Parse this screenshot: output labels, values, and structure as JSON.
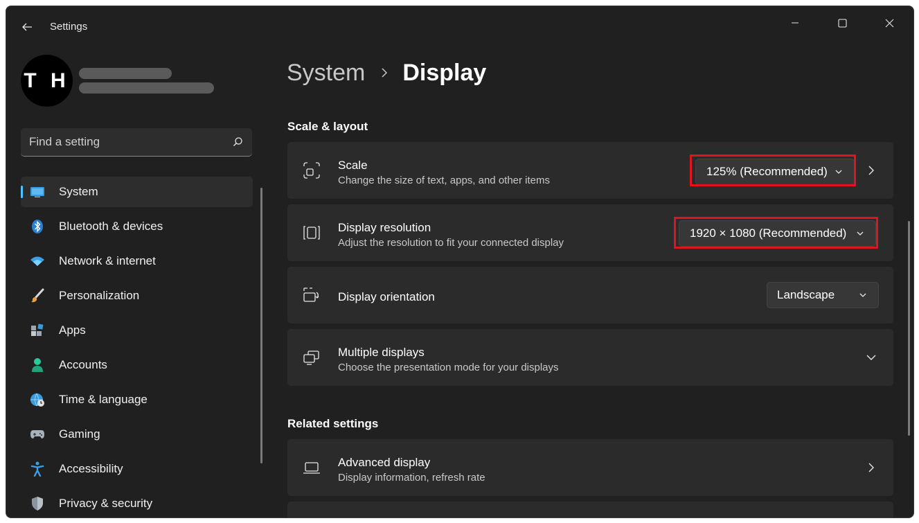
{
  "window": {
    "title": "Settings",
    "controls": [
      "minimize-icon",
      "maximize-icon",
      "close-icon"
    ]
  },
  "profile": {
    "initials": "T H"
  },
  "search": {
    "placeholder": "Find a setting"
  },
  "sidebar": {
    "items": [
      {
        "label": "System",
        "icon": "system-display-icon",
        "active": true
      },
      {
        "label": "Bluetooth & devices",
        "icon": "bluetooth-icon"
      },
      {
        "label": "Network & internet",
        "icon": "wifi-icon"
      },
      {
        "label": "Personalization",
        "icon": "paintbrush-icon"
      },
      {
        "label": "Apps",
        "icon": "apps-icon"
      },
      {
        "label": "Accounts",
        "icon": "person-icon"
      },
      {
        "label": "Time & language",
        "icon": "globe-clock-icon"
      },
      {
        "label": "Gaming",
        "icon": "gamepad-icon"
      },
      {
        "label": "Accessibility",
        "icon": "accessibility-icon"
      },
      {
        "label": "Privacy & security",
        "icon": "shield-icon"
      }
    ]
  },
  "breadcrumb": {
    "parent": "System",
    "current": "Display"
  },
  "sections": {
    "scale_layout": "Scale & layout",
    "related": "Related settings"
  },
  "cards": {
    "scale": {
      "title": "Scale",
      "subtitle": "Change the size of text, apps, and other items",
      "value": "125% (Recommended)"
    },
    "resolution": {
      "title": "Display resolution",
      "subtitle": "Adjust the resolution to fit your connected display",
      "value": "1920 × 1080 (Recommended)"
    },
    "orientation": {
      "title": "Display orientation",
      "value": "Landscape"
    },
    "multiple": {
      "title": "Multiple displays",
      "subtitle": "Choose the presentation mode for your displays"
    },
    "advanced": {
      "title": "Advanced display",
      "subtitle": "Display information, refresh rate"
    }
  },
  "colors": {
    "accent": "#4cc2ff",
    "highlight": "#e0141e",
    "background": "#202020",
    "card": "#2b2b2b"
  }
}
